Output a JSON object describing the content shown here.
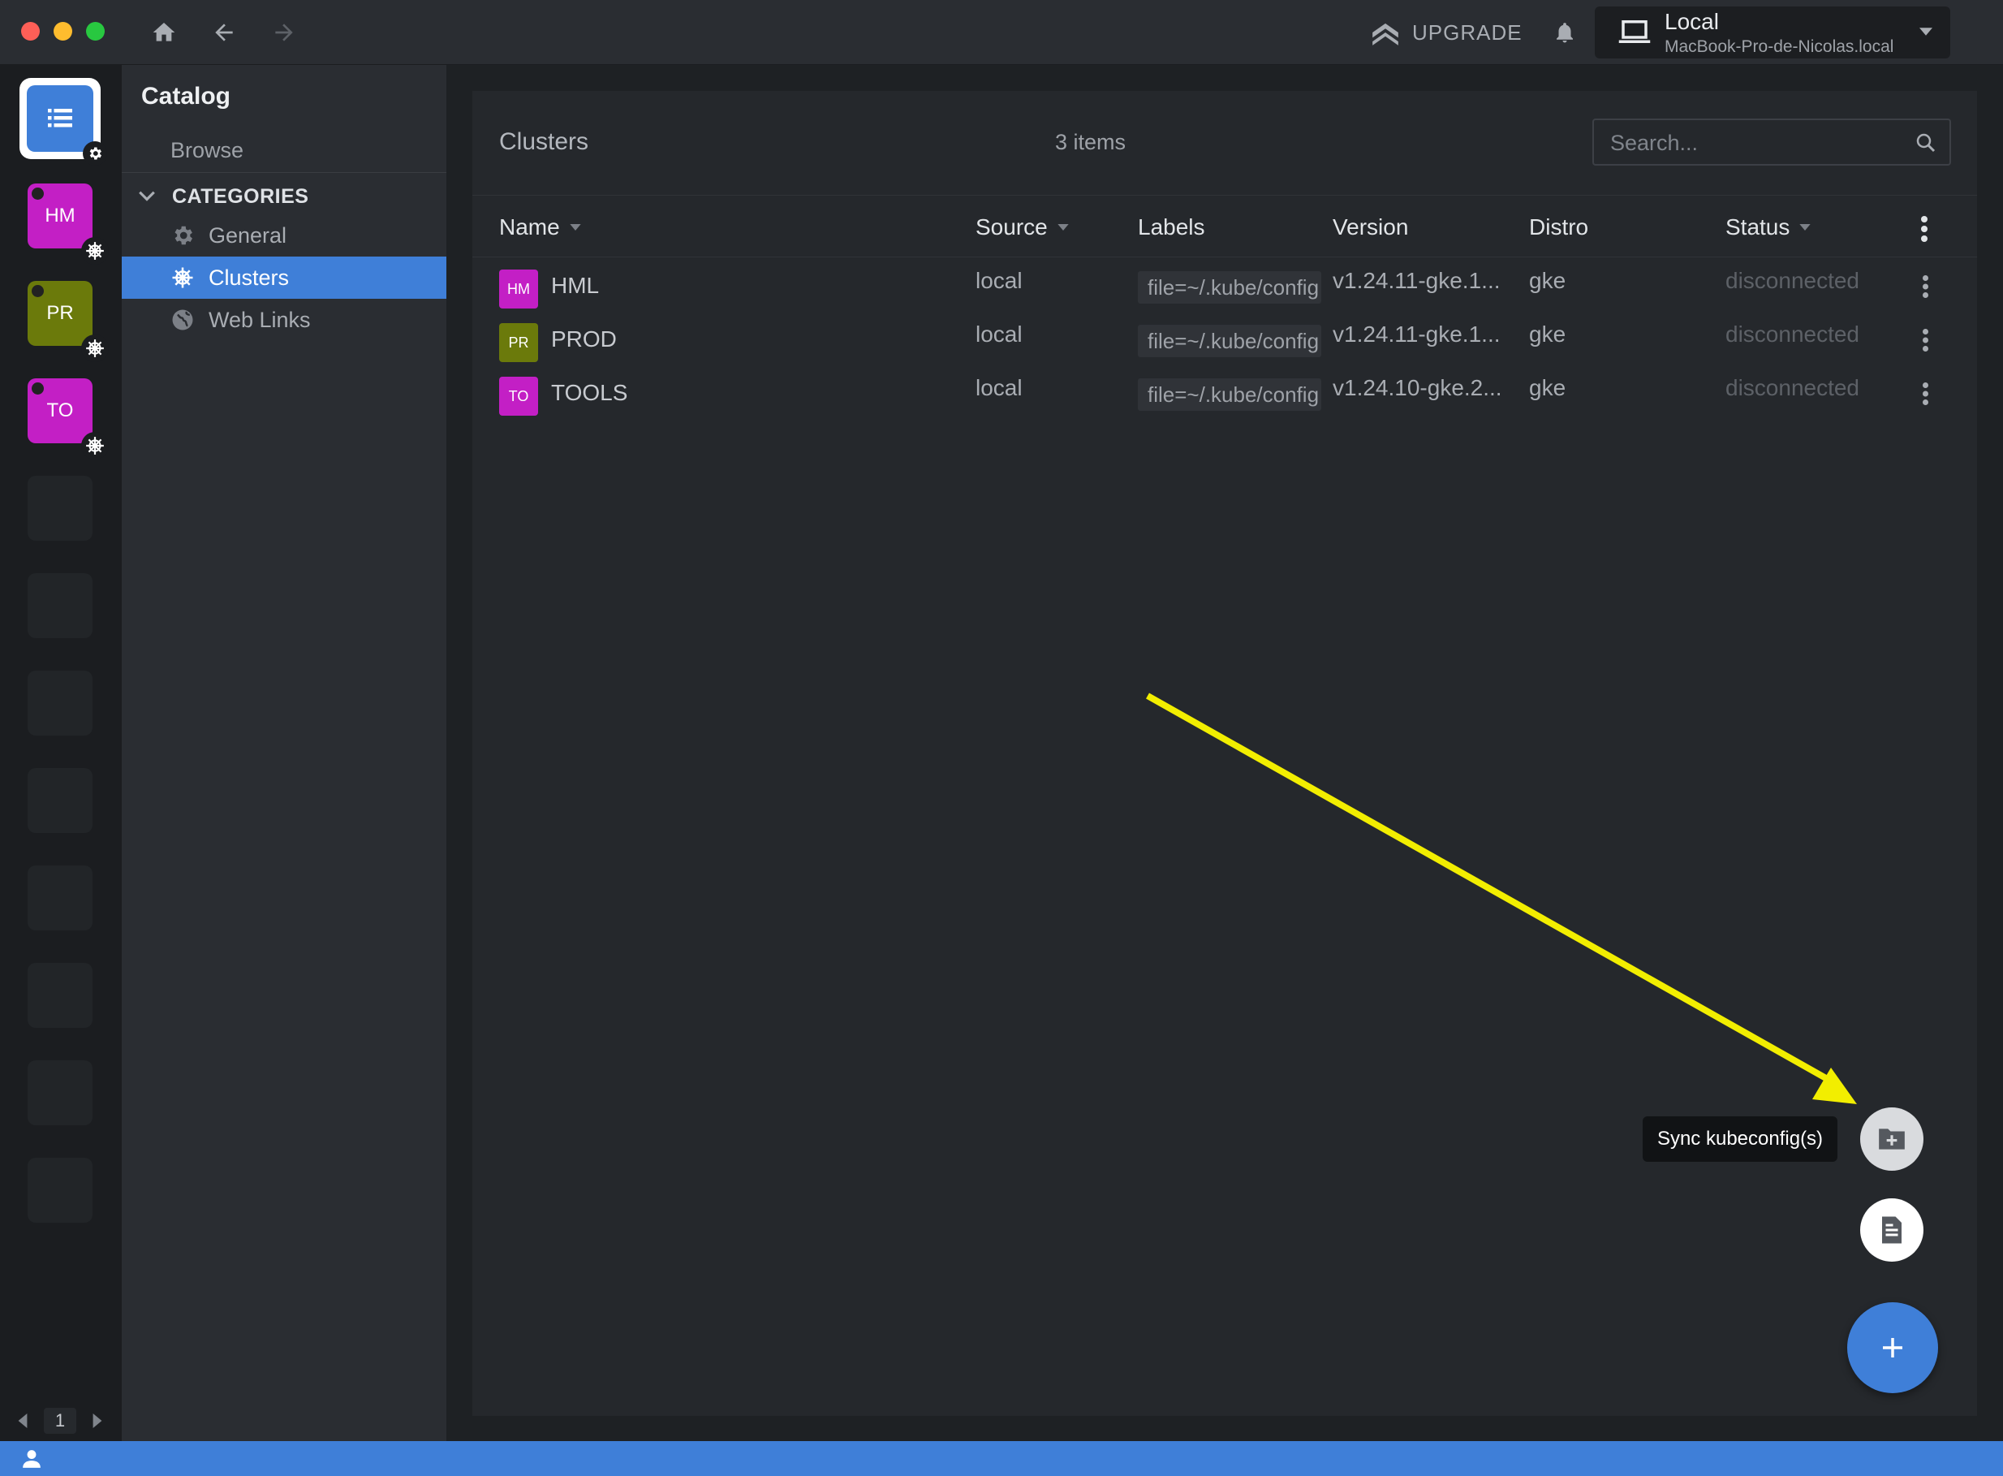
{
  "window": {
    "upgrade_label": "UPGRADE"
  },
  "host": {
    "title": "Local",
    "subtitle": "MacBook-Pro-de-Nicolas.local"
  },
  "hotbar": {
    "items": [
      {
        "label": "HM",
        "color": "#c31fc5"
      },
      {
        "label": "PR",
        "color": "#6b7a0b"
      },
      {
        "label": "TO",
        "color": "#c31fc5"
      }
    ],
    "page": "1"
  },
  "sidebar": {
    "title": "Catalog",
    "browse": "Browse",
    "categories_label": "CATEGORIES",
    "items": [
      {
        "label": "General",
        "icon": "gear-icon"
      },
      {
        "label": "Clusters",
        "icon": "helm-icon",
        "active": true
      },
      {
        "label": "Web Links",
        "icon": "globe-icon"
      }
    ]
  },
  "main": {
    "title": "Clusters",
    "count": "3 items",
    "search_placeholder": "Search...",
    "columns": {
      "name": "Name",
      "source": "Source",
      "labels": "Labels",
      "version": "Version",
      "distro": "Distro",
      "status": "Status"
    },
    "rows": [
      {
        "avatar": "HM",
        "avatar_color": "#c31fc5",
        "name": "HML",
        "source": "local",
        "label": "file=~/.kube/config",
        "version": "v1.24.11-gke.1...",
        "distro": "gke",
        "status": "disconnected"
      },
      {
        "avatar": "PR",
        "avatar_color": "#6b7a0b",
        "name": "PROD",
        "source": "local",
        "label": "file=~/.kube/config",
        "version": "v1.24.11-gke.1...",
        "distro": "gke",
        "status": "disconnected"
      },
      {
        "avatar": "TO",
        "avatar_color": "#c31fc5",
        "name": "TOOLS",
        "source": "local",
        "label": "file=~/.kube/config",
        "version": "v1.24.10-gke.2...",
        "distro": "gke",
        "status": "disconnected"
      }
    ]
  },
  "fab": {
    "tooltip": "Sync kubeconfig(s)"
  },
  "colors": {
    "accent": "#3f7fd8",
    "annotation_arrow": "#f2ee00"
  }
}
